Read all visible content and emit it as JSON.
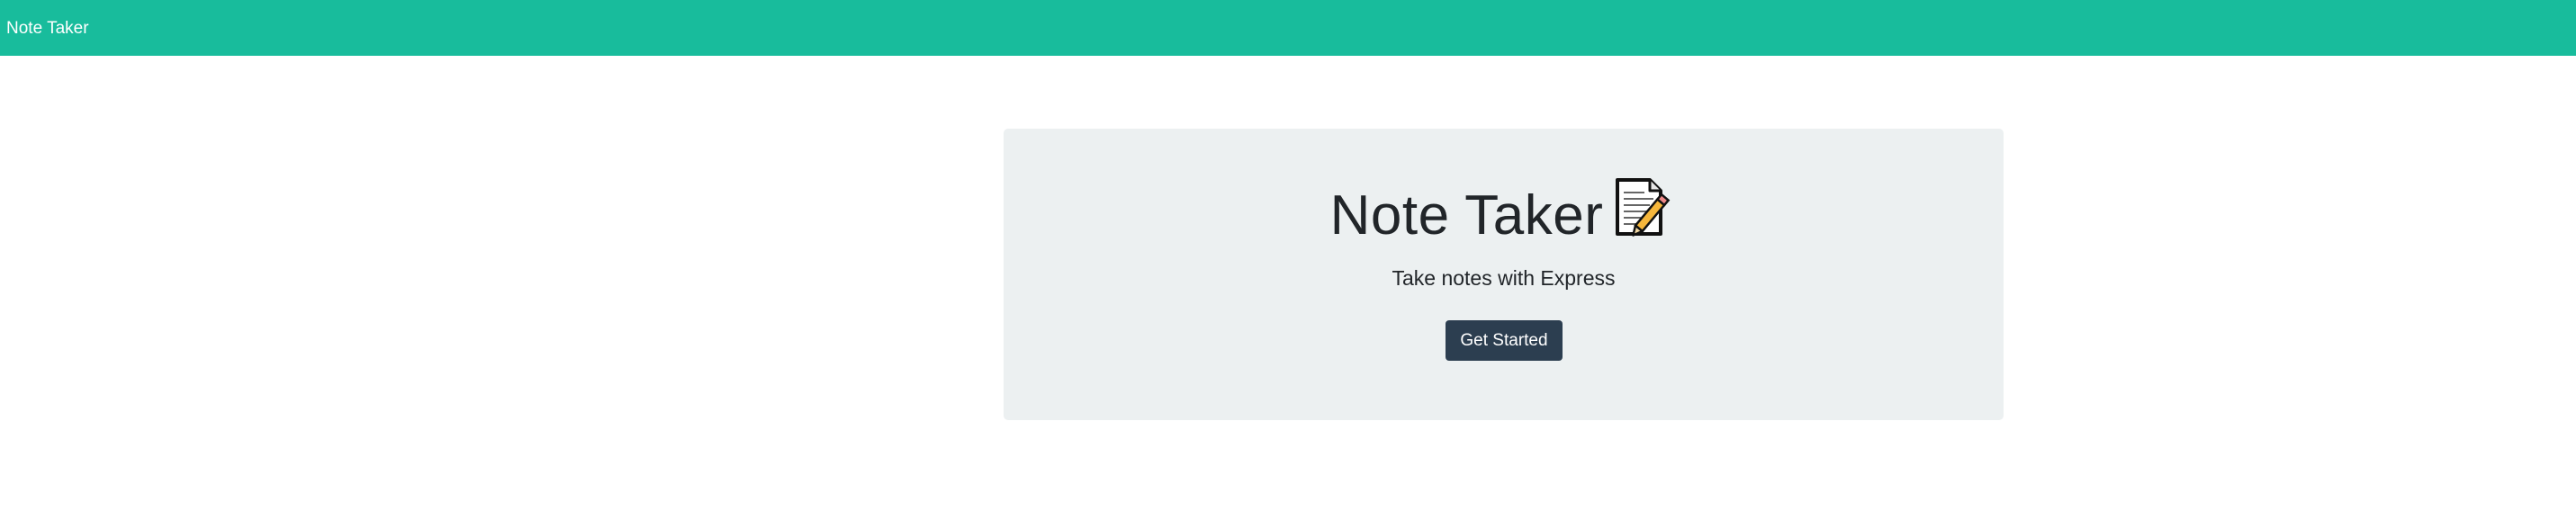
{
  "navbar": {
    "brand": "Note Taker",
    "color": "#18bc9c"
  },
  "hero": {
    "title": "Note Taker",
    "title_icon": "memo-icon",
    "subtitle": "Take notes with Express",
    "cta_label": "Get Started",
    "background": "#ecf0f1",
    "button_color": "#2c3e50"
  }
}
